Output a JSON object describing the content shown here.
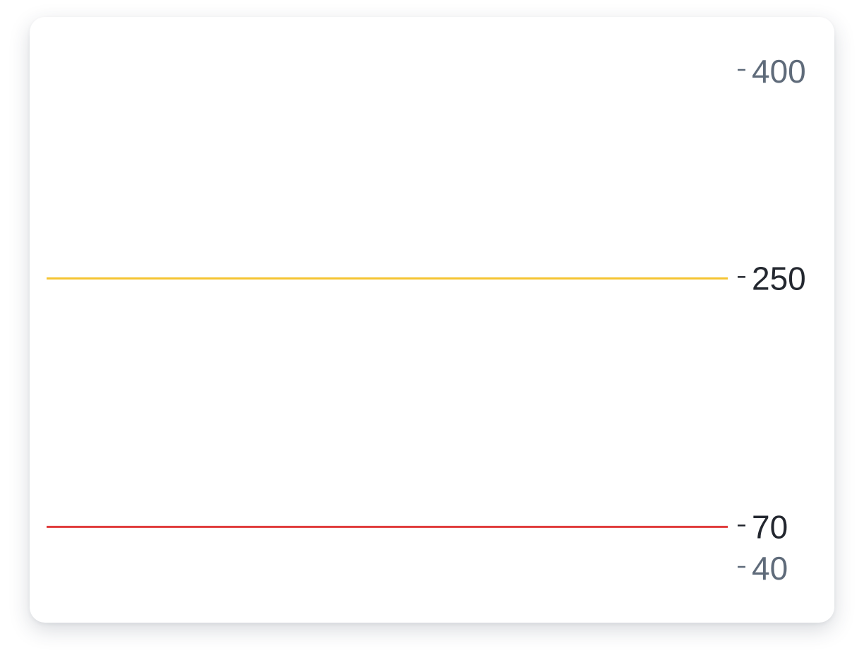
{
  "chart_data": {
    "type": "line",
    "title": "",
    "xlabel": "",
    "ylabel": "",
    "ylim": [
      40,
      400
    ],
    "grid": false,
    "y_ticks": [
      {
        "value": 400,
        "label": "400",
        "emphasized": false
      },
      {
        "value": 250,
        "label": "250",
        "emphasized": true
      },
      {
        "value": 70,
        "label": "70",
        "emphasized": true
      },
      {
        "value": 40,
        "label": "40",
        "emphasized": false
      }
    ],
    "series": [
      {
        "value": 250,
        "color": "#f5c431"
      },
      {
        "value": 70,
        "color": "#e03c3c"
      }
    ],
    "colors": {
      "tick_muted": "#5f6b7a",
      "tick_emphasized": "#23272f"
    }
  }
}
